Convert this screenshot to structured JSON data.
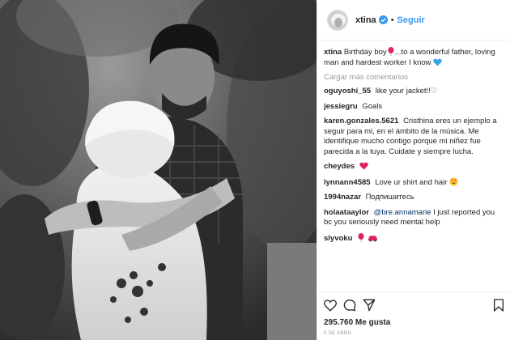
{
  "post": {
    "username": "xtina",
    "follow_label": "Seguir",
    "separator": "•",
    "caption_user": "xtina",
    "caption_text_1": "Birthday boy",
    "caption_text_2": "...to a wonderful father, loving man and hardest worker I know",
    "load_more": "Cargar más comentarios",
    "likes": "295.760 Me gusta",
    "date": "5 DE ABRIL"
  },
  "comments": [
    {
      "user": "oguyoshi_55",
      "text": "like your jacket!!♡"
    },
    {
      "user": "jessiegru",
      "text": "Goals"
    },
    {
      "user": "karen.gonzales.5621",
      "text": "Cristhina eres un ejemplo a seguir para mi, en el ámbito de la música. Me identifique mucho contigo porque mi niñez fue parecida a la tuya. Cuidate y siempre lucha."
    },
    {
      "user": "cheydes",
      "text": ""
    },
    {
      "user": "lynnann4585",
      "text": "Love ur shirt and hair"
    },
    {
      "user": "1994nazar",
      "text": "Подпишитесь"
    },
    {
      "user": "holaataaylor",
      "mention": "@bre.annamarie",
      "text": "I just reported you bc you seriously need mental help"
    },
    {
      "user": "slyvoku",
      "text": ""
    }
  ],
  "colors": {
    "accent": "#3897f0",
    "heart": "#ed4956",
    "verified": "#3897f0"
  },
  "icons": [
    "verified-badge-icon",
    "heart-icon",
    "comment-icon",
    "share-icon",
    "bookmark-icon",
    "red-balloon-emoji",
    "blue-heart-emoji",
    "heart-eyes-emoji",
    "red-car-emoji"
  ]
}
